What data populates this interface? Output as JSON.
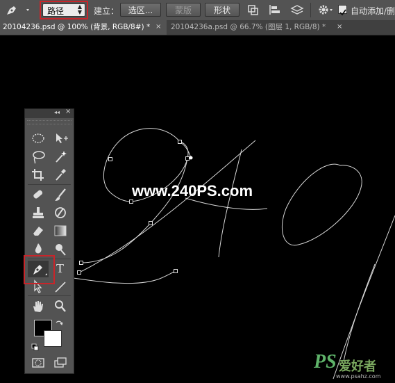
{
  "options_bar": {
    "mode_select": "路径",
    "create_label": "建立：",
    "selection_button": "选区...",
    "mask_button": "蒙版",
    "shape_button": "形状",
    "auto_add_label": "自动添加/删"
  },
  "tabs": [
    {
      "label": "20104236.psd @ 100% (背景, RGB/8#) *",
      "close": "×"
    },
    {
      "label": "20104236a.psd @ 66.7% (图层 1, RGB/8) *",
      "close": "×"
    }
  ],
  "toolbox": {
    "collapse_glyph": "◂◂",
    "close_glyph": "×",
    "type_tool_glyph": "T"
  },
  "canvas": {
    "watermark": "www.240PS.com"
  },
  "logo": {
    "ps": "PS",
    "cn": "爱好者",
    "url": "www.psahz.com"
  }
}
